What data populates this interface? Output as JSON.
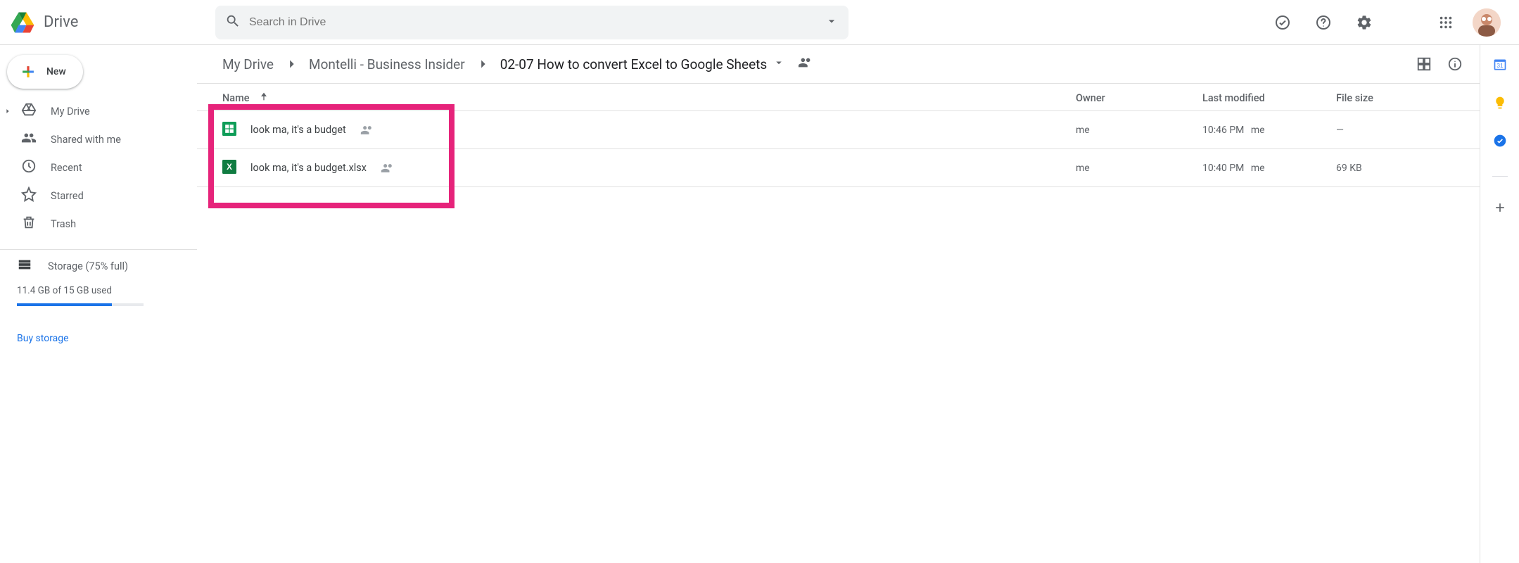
{
  "header": {
    "product_name": "Drive",
    "search_placeholder": "Search in Drive"
  },
  "sidebar": {
    "new_button": "New",
    "items": [
      "My Drive",
      "Shared with me",
      "Recent",
      "Starred",
      "Trash"
    ],
    "storage_label": "Storage (75% full)",
    "storage_text": "11.4 GB of 15 GB used",
    "buy_storage": "Buy storage"
  },
  "breadcrumb": [
    "My Drive",
    "Montelli - Business Insider",
    "02-07 How to convert Excel to Google Sheets"
  ],
  "columns": {
    "name": "Name",
    "owner": "Owner",
    "modified": "Last modified",
    "size": "File size"
  },
  "files": [
    {
      "type": "sheets",
      "name": "look ma, it's a budget",
      "owner": "me",
      "modified_time": "10:46 PM",
      "modified_by": "me",
      "size": "—"
    },
    {
      "type": "excel",
      "name": "look ma, it's a budget.xlsx",
      "owner": "me",
      "modified_time": "10:40 PM",
      "modified_by": "me",
      "size": "69 KB"
    }
  ]
}
